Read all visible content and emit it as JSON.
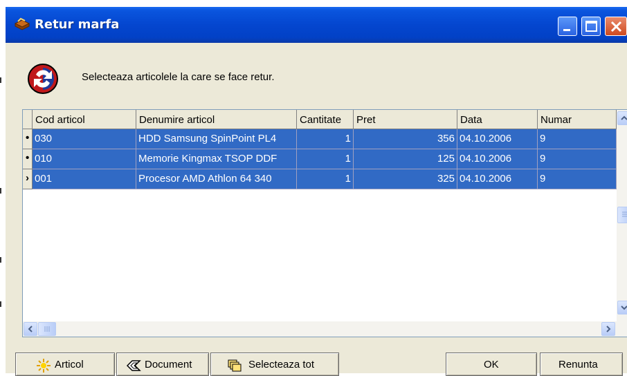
{
  "window": {
    "title": "Retur marfa",
    "icon": "folder-box-icon",
    "controls": [
      "minimize-icon",
      "maximize-icon",
      "close-icon"
    ]
  },
  "header": {
    "icon": "refresh-return-icon",
    "message": "Selecteaza articolele la care se face retur."
  },
  "grid": {
    "columns": [
      "Cod articol",
      "Denumire articol",
      "Cantitate",
      "Pret",
      "Data",
      "Numar"
    ],
    "rows": [
      {
        "indicator": "•",
        "cod": "030",
        "denumire": "HDD Samsung SpinPoint PL4",
        "cantitate": "1",
        "pret": "356",
        "data": "04.10.2006",
        "numar": "9"
      },
      {
        "indicator": "•",
        "cod": "010",
        "denumire": "Memorie Kingmax TSOP DDF",
        "cantitate": "1",
        "pret": "125",
        "data": "04.10.2006",
        "numar": "9"
      },
      {
        "indicator": "›",
        "cod": "001",
        "denumire": "Procesor AMD Athlon 64 340",
        "cantitate": "1",
        "pret": "325",
        "data": "04.10.2006",
        "numar": "9"
      }
    ],
    "selection_color": "#316ac5"
  },
  "buttons": {
    "articol": "Articol",
    "document": "Document",
    "selecteaza_tot": "Selecteaza tot",
    "ok": "OK",
    "renunta": "Renunta"
  }
}
